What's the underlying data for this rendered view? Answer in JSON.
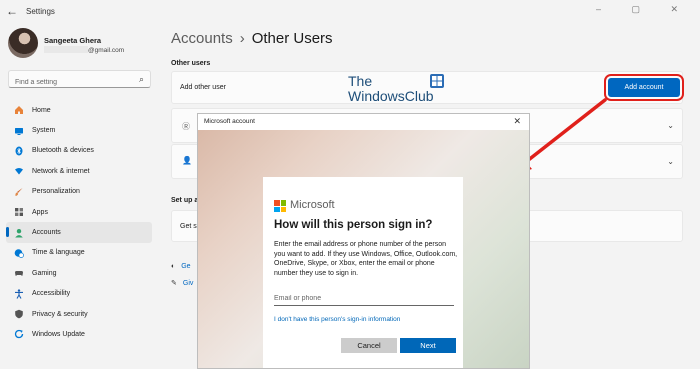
{
  "app": {
    "title": "Settings",
    "window_controls": "– ▢ ✕"
  },
  "user": {
    "name": "Sangeeta Ghera",
    "email_suffix": "@gmail.com"
  },
  "search": {
    "placeholder": "Find a setting"
  },
  "sidebar": {
    "items": [
      {
        "label": "Home",
        "icon": "home-icon",
        "color": "#e8833a"
      },
      {
        "label": "System",
        "icon": "system-icon",
        "color": "#0078d4"
      },
      {
        "label": "Bluetooth & devices",
        "icon": "bluetooth-icon",
        "color": "#0078d4"
      },
      {
        "label": "Network & internet",
        "icon": "wifi-icon",
        "color": "#0078d4"
      },
      {
        "label": "Personalization",
        "icon": "brush-icon",
        "color": "#d26a33"
      },
      {
        "label": "Apps",
        "icon": "apps-icon",
        "color": "#555555"
      },
      {
        "label": "Accounts",
        "icon": "person-icon",
        "color": "#2fa36b",
        "active": true
      },
      {
        "label": "Time & language",
        "icon": "globe-clock-icon",
        "color": "#0078d4"
      },
      {
        "label": "Gaming",
        "icon": "gamepad-icon",
        "color": "#555555"
      },
      {
        "label": "Accessibility",
        "icon": "accessibility-icon",
        "color": "#1a5fb4"
      },
      {
        "label": "Privacy & security",
        "icon": "shield-icon",
        "color": "#555555"
      },
      {
        "label": "Windows Update",
        "icon": "update-icon",
        "color": "#0078d4"
      }
    ]
  },
  "breadcrumb": {
    "parent": "Accounts",
    "separator": "›",
    "current": "Other Users"
  },
  "other_users": {
    "section_label": "Other users",
    "add_other_user_label": "Add other user",
    "add_account_button": "Add account"
  },
  "setup_section": {
    "label_partial": "Set up a",
    "card_text_partial": "Get s"
  },
  "related_links": [
    {
      "text": "Ge"
    },
    {
      "text": "Giv"
    }
  ],
  "watermark": {
    "line1": "The",
    "line2": "WindowsClub"
  },
  "dialog": {
    "title": "Microsoft account",
    "close": "✕",
    "brand": "Microsoft",
    "heading": "How will this person sign in?",
    "description": "Enter the email address or phone number of the person you want to add. If they use Windows, Office, Outlook.com, OneDrive, Skype, or Xbox, enter the email or phone number they use to sign in.",
    "input_placeholder": "Email or phone",
    "no_info_link": "I don't have this person's sign-in information",
    "cancel_button": "Cancel",
    "next_button": "Next"
  },
  "colors": {
    "accent": "#0067c0",
    "annotation": "#e0201b"
  }
}
